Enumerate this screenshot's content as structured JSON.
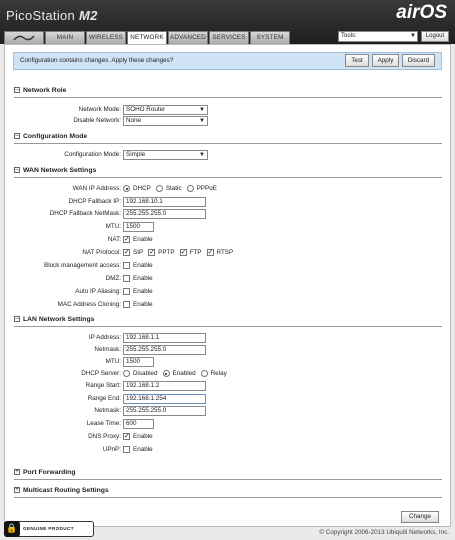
{
  "header": {
    "product": "PicoStation",
    "model": "M2",
    "brand": "airOS",
    "brand_air": "air",
    "brand_os": "OS"
  },
  "tabs": [
    "MAIN",
    "WIRELESS",
    "NETWORK",
    "ADVANCED",
    "SERVICES",
    "SYSTEM"
  ],
  "active_tab": "NETWORK",
  "tools": {
    "value": "Tools:"
  },
  "logout_label": "Logout",
  "notice": {
    "text": "Configuration contains changes. Apply these changes?",
    "test": "Test",
    "apply": "Apply",
    "discard": "Discard"
  },
  "network_role": {
    "title": "Network Role",
    "network_mode_label": "Network Mode:",
    "network_mode": "SOHO Router",
    "disable_network_label": "Disable Network:",
    "disable_network": "None"
  },
  "config_mode": {
    "title": "Configuration Mode",
    "label": "Configuration Mode:",
    "value": "Simple"
  },
  "wan": {
    "title": "WAN Network Settings",
    "ip_address_label": "WAN IP Address:",
    "ip_options": [
      "DHCP",
      "Static",
      "PPPoE"
    ],
    "ip_selected": "DHCP",
    "fallback_ip_label": "DHCP Fallback IP:",
    "fallback_ip": "192.168.10.1",
    "fallback_mask_label": "DHCP Fallback NetMask:",
    "fallback_mask": "255.255.255.0",
    "mtu_label": "MTU:",
    "mtu": "1500",
    "nat_label": "NAT:",
    "nat": "Enable",
    "nat_protocol_label": "NAT Protocol:",
    "nat_protocols": [
      "SIP",
      "PPTP",
      "FTP",
      "RTSP"
    ],
    "block_mgmt_label": "Block management access:",
    "block_mgmt": "Enable",
    "dmz_label": "DMZ:",
    "dmz": "Enable",
    "auto_ip_label": "Auto IP Aliasing:",
    "auto_ip": "Enable",
    "mac_clone_label": "MAC Address Cloning:",
    "mac_clone": "Enable"
  },
  "lan": {
    "title": "LAN Network Settings",
    "ip_label": "IP Address:",
    "ip": "192.168.1.1",
    "netmask_label": "Netmask:",
    "netmask": "255.255.255.0",
    "mtu_label": "MTU:",
    "mtu": "1500",
    "dhcp_label": "DHCP Server:",
    "dhcp_options": [
      "Disabled",
      "Enabled",
      "Relay"
    ],
    "dhcp_selected": "Enabled",
    "range_start_label": "Range Start:",
    "range_start": "192.168.1.2",
    "range_end_label": "Range End:",
    "range_end": "192.168.1.254",
    "dhcp_netmask_label": "Netmask:",
    "dhcp_netmask": "255.255.255.0",
    "lease_label": "Lease Time:",
    "lease": "600",
    "dns_proxy_label": "DNS Proxy:",
    "dns_proxy": "Enable",
    "upnp_label": "UPnP:",
    "upnp": "Enable"
  },
  "port_forwarding": {
    "title": "Port Forwarding"
  },
  "multicast": {
    "title": "Multicast Routing Settings"
  },
  "change_label": "Change",
  "genuine": "GENUINE  PRODUCT",
  "copyright": "© Copyright 2006-2013 Ubiquiti Networks, Inc."
}
